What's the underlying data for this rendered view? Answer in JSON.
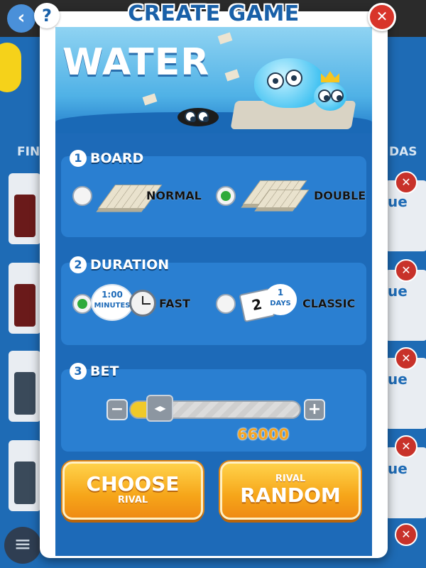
{
  "background": {
    "back_icon": "back-arrow-icon",
    "left_label": "FIN",
    "right_label": "DAS",
    "row_text": "ue",
    "menu_icon": "hamburger-menu-icon"
  },
  "dialog": {
    "title": "CREATE GAME",
    "help_label": "?",
    "close_label": "✕",
    "hero_title": "WATER"
  },
  "board": {
    "number": "1",
    "title": "BOARD",
    "options": [
      {
        "label": "NORMAL",
        "selected": false
      },
      {
        "label": "DOUBLE",
        "selected": true
      }
    ]
  },
  "duration": {
    "number": "2",
    "title": "DURATION",
    "options": [
      {
        "label": "FAST",
        "badge_value": "1:00",
        "badge_unit": "MINUTES",
        "selected": true
      },
      {
        "label": "CLASSIC",
        "badge_value": "1",
        "badge_unit": "DAYS",
        "calendar_value": "2",
        "selected": false
      }
    ]
  },
  "bet": {
    "number": "3",
    "title": "BET",
    "minus_label": "−",
    "plus_label": "+",
    "thumb_label": "◂▸",
    "value": "66000",
    "slider_fraction": 0.12
  },
  "actions": {
    "choose": {
      "main": "CHOOSE",
      "sub": "RIVAL"
    },
    "random": {
      "sub": "RIVAL",
      "main": "RANDOM"
    }
  },
  "colors": {
    "accent_blue": "#1960a8",
    "selected_green": "#2faa3a",
    "button_orange": "#f6a519",
    "bet_value": "#f5a31f",
    "close_red": "#d8342a"
  }
}
